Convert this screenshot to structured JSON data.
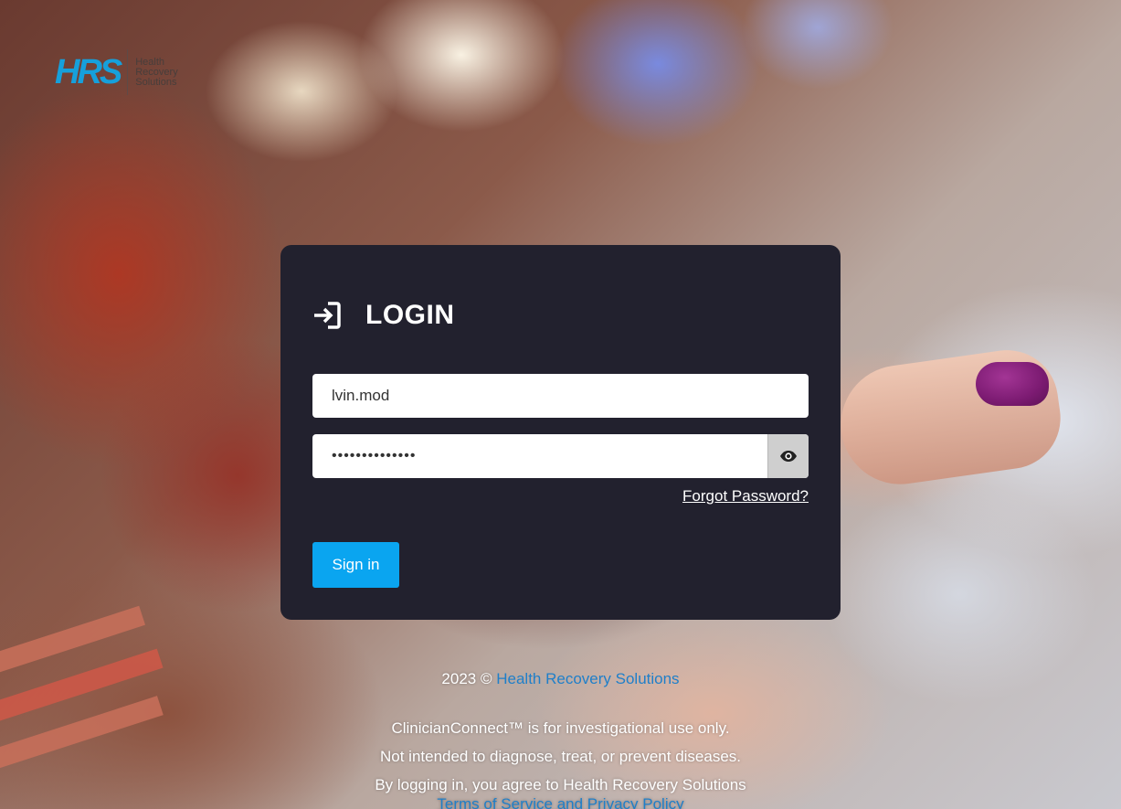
{
  "logo": {
    "mark": "HRS",
    "line1": "Health",
    "line2": "Recovery",
    "line3": "Solutions"
  },
  "login": {
    "title": "LOGIN",
    "username_value": "lvin.mod",
    "password_masked": "••••••••••••••",
    "forgot_label": "Forgot Password?",
    "signin_label": "Sign in"
  },
  "footer": {
    "copyright_prefix": "2023 ©",
    "company_link": "Health Recovery Solutions",
    "disclaimer_line1": "ClinicianConnect™ is for investigational use only.",
    "disclaimer_line2": "Not intended to diagnose, treat, or prevent diseases.",
    "disclaimer_line3": "By logging in, you agree to Health Recovery Solutions",
    "terms_link": "Terms of Service and Privacy Policy"
  },
  "colors": {
    "card_bg": "#22212e",
    "accent": "#0aa5f0",
    "link": "#1f7fc9",
    "logo_blue": "#16a0db"
  },
  "icons": {
    "login": "login-arrow-icon",
    "password_toggle": "eye-icon"
  }
}
